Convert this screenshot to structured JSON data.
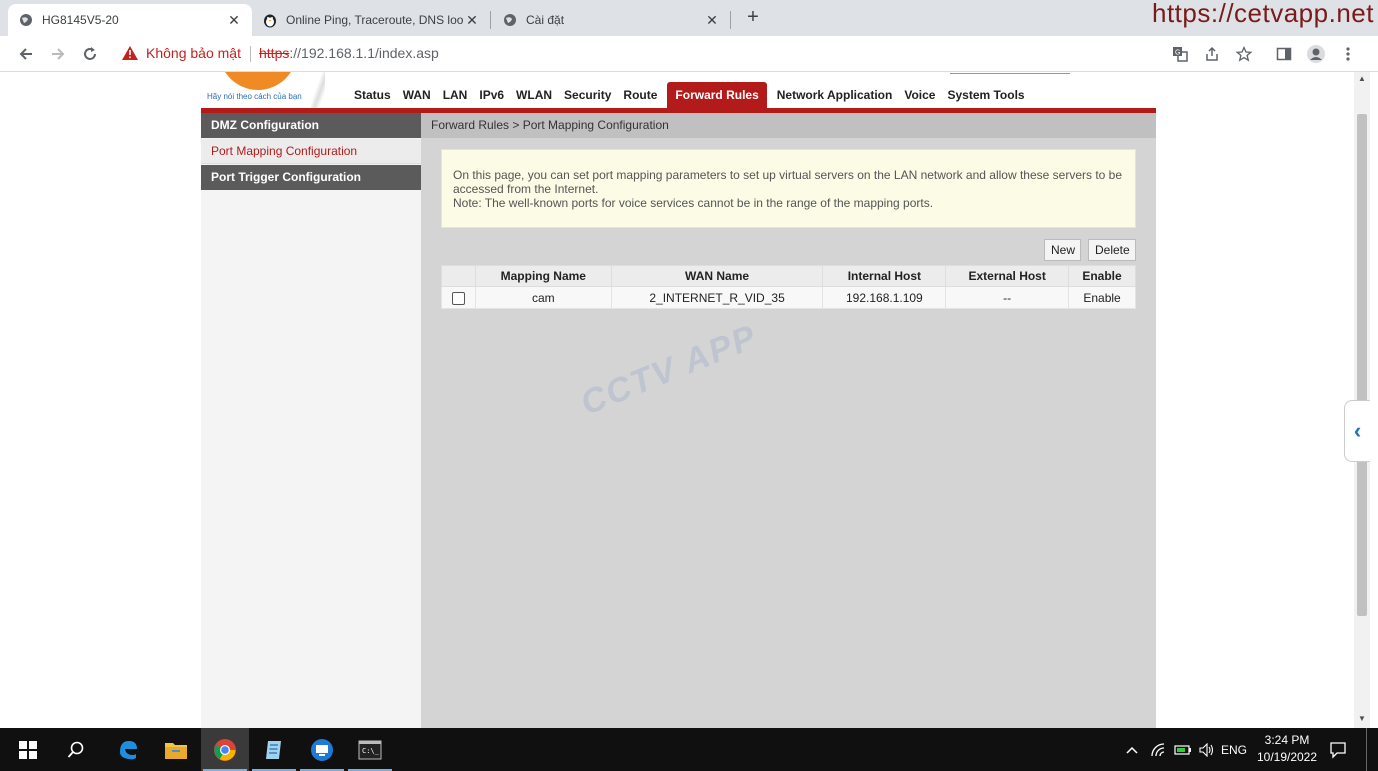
{
  "browser": {
    "tabs": [
      {
        "title": "HG8145V5-20",
        "icon": "globe-icon",
        "active": true
      },
      {
        "title": "Online Ping, Traceroute, DNS lookup",
        "icon": "penguin-icon",
        "active": false
      },
      {
        "title": "Cài đặt",
        "icon": "gear-globe-icon",
        "active": false
      }
    ],
    "tab_close": "✕",
    "new_tab": "+",
    "watermark": "https://cetvapp.net",
    "security_label": "Không bảo mật",
    "url_scheme": "https",
    "url_rest": "://192.168.1.1/index.asp"
  },
  "router": {
    "slogan": "Hãy nói theo cách của bạn",
    "nav": [
      "Status",
      "WAN",
      "LAN",
      "IPv6",
      "WLAN",
      "Security",
      "Route",
      "Forward Rules",
      "Network Application",
      "Voice",
      "System Tools"
    ],
    "nav_active": "Forward Rules",
    "sidebar": [
      "DMZ Configuration",
      "Port Mapping Configuration",
      "Port Trigger Configuration"
    ],
    "sidebar_selected": "Port Mapping Configuration",
    "breadcrumb": "Forward Rules > Port Mapping Configuration",
    "notice_line1": "On this page, you can set port mapping parameters to set up virtual servers on the LAN network and allow these servers to be accessed from the Internet.",
    "notice_line2": "Note: The well-known ports for voice services cannot be in the range of the mapping ports.",
    "btn_new": "New",
    "btn_delete": "Delete",
    "table": {
      "headers": [
        "",
        "Mapping Name",
        "WAN Name",
        "Internal Host",
        "External Host",
        "Enable"
      ],
      "rows": [
        {
          "checked": false,
          "mapping_name": "cam",
          "wan_name": "2_INTERNET_R_VID_35",
          "internal_host": "192.168.1.109",
          "external_host": "--",
          "enable": "Enable"
        }
      ]
    },
    "watermark": "CCTV APP"
  },
  "taskbar": {
    "lang": "ENG",
    "time": "3:24 PM",
    "date": "10/19/2022"
  },
  "colors": {
    "brand_red": "#b31b1b",
    "logo_orange": "#f08a24",
    "insecure_red": "#c5221f"
  }
}
